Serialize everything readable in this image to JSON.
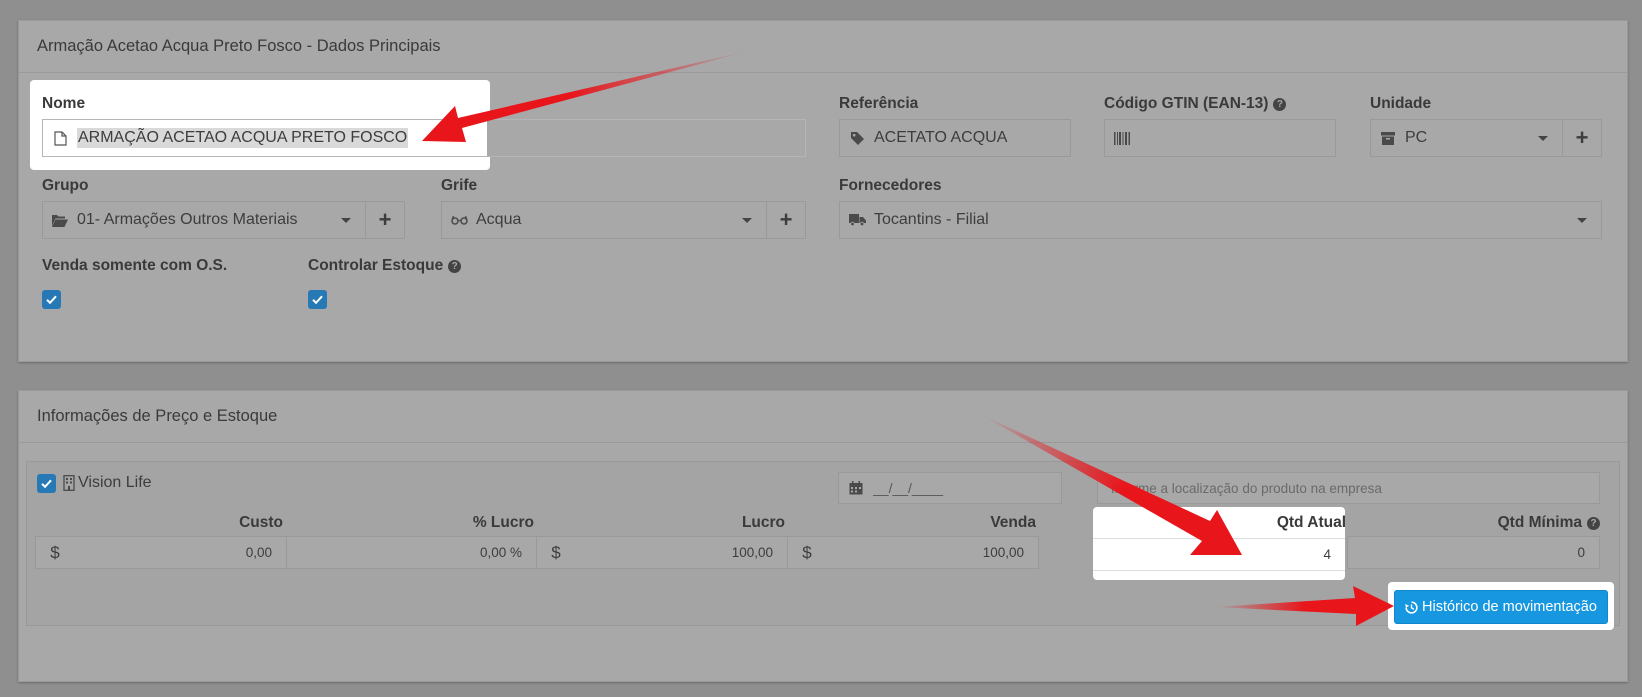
{
  "panel1": {
    "title": "Armação Acetao Acqua Preto Fosco - Dados Principais",
    "nome_label": "Nome",
    "nome_value": "ARMAÇÃO ACETAO ACQUA PRETO FOSCO",
    "referencia_label": "Referência",
    "referencia_value": "ACETATO ACQUA",
    "gtin_label": "Código GTIN (EAN-13)",
    "gtin_value": "",
    "unidade_label": "Unidade",
    "unidade_value": "PC",
    "grupo_label": "Grupo",
    "grupo_value": "01- Armações Outros Materiais",
    "grife_label": "Grife",
    "grife_value": "Acqua",
    "fornecedores_label": "Fornecedores",
    "fornecedores_value": "Tocantins - Filial",
    "venda_os_label": "Venda somente com O.S.",
    "controlar_estoque_label": "Controlar Estoque",
    "venda_os_checked": true,
    "controlar_estoque_checked": true
  },
  "panel2": {
    "title": "Informações de Preço e Estoque",
    "store_name": "Vision Life",
    "date_placeholder": "__/__/____",
    "location_placeholder": "Informe a localização do produto na empresa",
    "columns": {
      "custo": "Custo",
      "lucro_pct": "% Lucro",
      "lucro": "Lucro",
      "venda": "Venda",
      "qtd_atual": "Qtd Atual",
      "qtd_minima": "Qtd Mínima"
    },
    "values": {
      "currency": "$",
      "custo": "0,00",
      "lucro_pct": "0,00 %",
      "lucro": "100,00",
      "venda": "100,00",
      "qtd_atual": "4",
      "qtd_minima": "0"
    },
    "historico_button": "Histórico de movimentação"
  },
  "colors": {
    "checkbox": "#2779b6",
    "button": "#1797e0",
    "arrow": "#e8151b",
    "overlay": "#8f8f8f"
  }
}
